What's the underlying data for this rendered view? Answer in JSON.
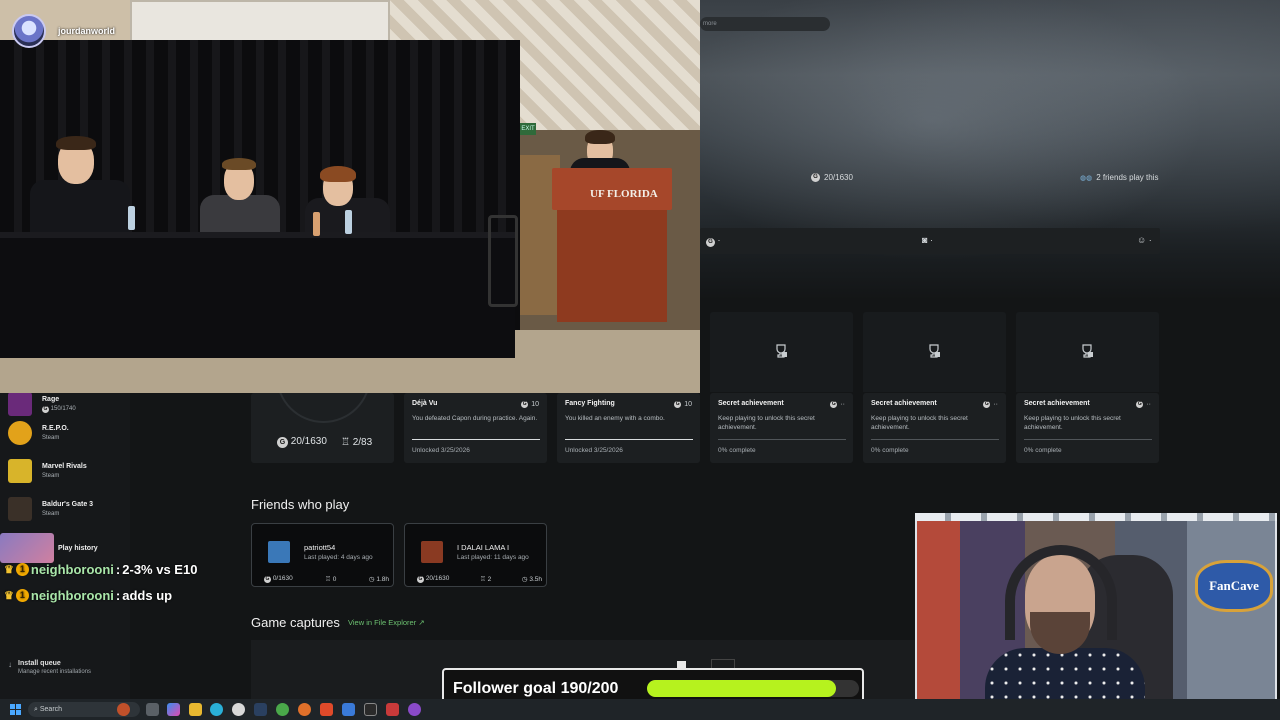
{
  "stream": {
    "channel_name": "jourdanworld",
    "podium_logo": "UF FLORIDA",
    "exit_sign": "EXIT"
  },
  "xbox": {
    "search_placeholder": "more",
    "hero_gamerscore": "20/1630",
    "hero_friends": "2 friends play this",
    "tabs": [
      "·",
      "·",
      "·"
    ],
    "sidebar": [
      {
        "title": "Rage",
        "sub": "150/1740",
        "color": "#6a2a7a"
      },
      {
        "title": "R.E.P.O.",
        "sub": "Steam",
        "color": "#e2a21a"
      },
      {
        "title": "Marvel Rivals",
        "sub": "Steam",
        "color": "#d8b42a"
      },
      {
        "title": "Baldur's Gate 3",
        "sub": "Steam",
        "color": "#3a3028"
      },
      {
        "title": "Play history",
        "sub": "",
        "color": "#7a6aa8"
      }
    ],
    "install_queue": {
      "title": "Install queue",
      "sub": "Manage recent installations"
    },
    "progress": {
      "gamerscore": "20/1630",
      "achievements": "2/83"
    },
    "achievements": [
      {
        "title": "Déjà Vu",
        "score": "10",
        "desc": "You defeated Capon during practice. Again.",
        "status": "Unlocked 3/25/2026",
        "full": true
      },
      {
        "title": "Fancy Fighting",
        "score": "10",
        "desc": "You killed an enemy with a combo.",
        "status": "Unlocked 3/25/2026",
        "full": true
      },
      {
        "title": "Secret achievement",
        "score": "··",
        "desc": "Keep playing to unlock this secret achievement.",
        "status": "0% complete",
        "full": false
      },
      {
        "title": "Secret achievement",
        "score": "··",
        "desc": "Keep playing to unlock this secret achievement.",
        "status": "0% complete",
        "full": false
      },
      {
        "title": "Secret achievement",
        "score": "··",
        "desc": "Keep playing to unlock this secret achievement.",
        "status": "0% complete",
        "full": false
      }
    ],
    "friends_heading": "Friends who play",
    "friends": [
      {
        "name": "patriott54",
        "last": "Last played: 4 days ago",
        "gs": "0/1630",
        "ach": "0",
        "time": "1.8h",
        "color": "#3a78b8"
      },
      {
        "name": "I DALAI LAMA I",
        "last": "Last played: 11 days ago",
        "gs": "20/1630",
        "ach": "2",
        "time": "3.5h",
        "color": "#8a3a22"
      }
    ],
    "captures_heading": "Game captures",
    "captures_link": "View in File Explorer"
  },
  "chat": [
    {
      "user": "neighborooni",
      "message": "2-3% vs E10"
    },
    {
      "user": "neighborooni",
      "message": "adds up"
    }
  ],
  "follower_goal": {
    "label": "Follower goal 190/200",
    "current": 190,
    "target": 200
  },
  "webcam": {
    "badge_text": "FanCave"
  },
  "taskbar": {
    "search": "Search"
  }
}
